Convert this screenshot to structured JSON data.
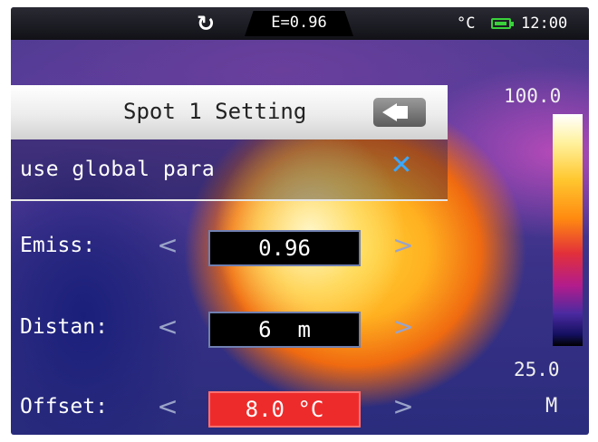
{
  "statusbar": {
    "refresh_icon": "refresh-icon",
    "emissivity": "E=0.96",
    "unit": "°C",
    "battery_icon": "battery-icon",
    "time": "12:00"
  },
  "panel": {
    "title": "Spot 1 Setting",
    "back_icon": "back-arrow-icon",
    "global_option": "use global para",
    "global_toggle_icon": "close-x-icon",
    "params": [
      {
        "label": "Emiss:",
        "value": "0.96"
      },
      {
        "label": "Distan:",
        "value": "6  m"
      },
      {
        "label": "Offset:",
        "value": "8.0 °C"
      }
    ]
  },
  "scale": {
    "max": "100.0",
    "min": "25.0",
    "mode": "M"
  },
  "colors": {
    "accent_blue": "#3aa8ff",
    "active_field": "#ee2b2b",
    "battery": "#39d13a"
  }
}
